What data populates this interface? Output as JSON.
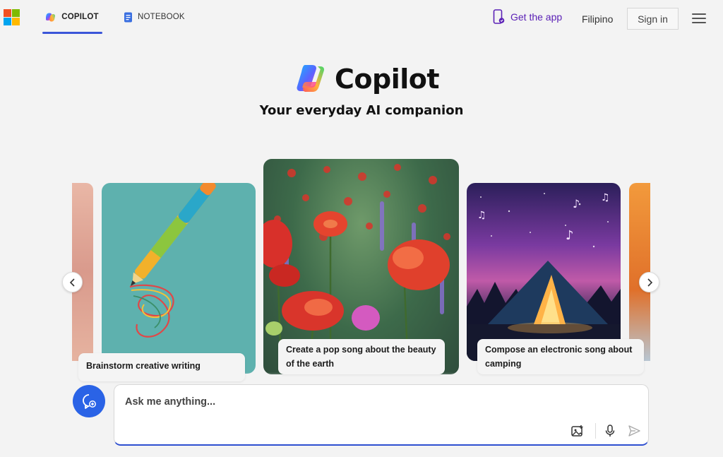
{
  "header": {
    "tabs": [
      {
        "label": "COPILOT",
        "active": true
      },
      {
        "label": "NOTEBOOK",
        "active": false
      }
    ],
    "get_app_label": "Get the app",
    "language": "Filipino",
    "sign_in_label": "Sign in"
  },
  "hero": {
    "title": "Copilot",
    "subtitle": "Your everyday AI companion"
  },
  "carousel": {
    "cards": [
      {
        "caption": "Brainstorm creative writing",
        "icon": "pen-illustration"
      },
      {
        "caption": "Create a pop song about the beauty of the earth",
        "icon": "poppy-field-illustration"
      },
      {
        "caption": "Compose an electronic song about camping",
        "icon": "tent-night-illustration"
      }
    ]
  },
  "composer": {
    "placeholder": "Ask me anything..."
  },
  "colors": {
    "accent": "#2a63e6",
    "tab_underline": "#3a55d8",
    "get_app": "#5b21b6"
  }
}
